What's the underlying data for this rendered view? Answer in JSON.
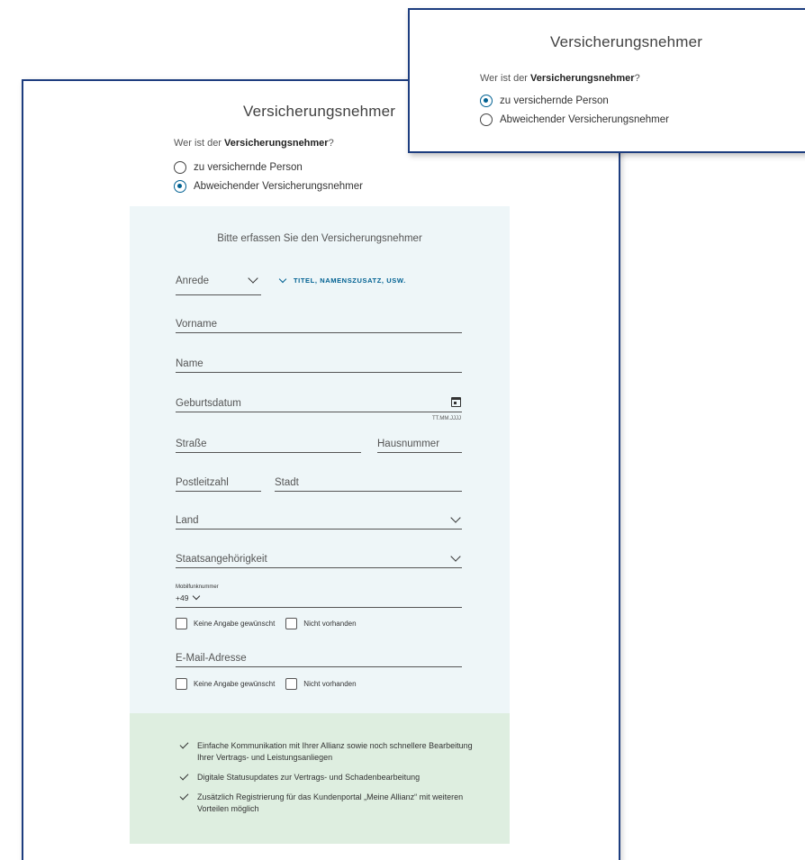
{
  "main": {
    "title": "Versicherungsnehmer",
    "question_prefix": "Wer ist der ",
    "question_bold": "Versicherungsnehmer",
    "question_suffix": "?",
    "options": [
      {
        "label": "zu versichernde Person",
        "checked": false
      },
      {
        "label": "Abweichender Versicherungsnehmer",
        "checked": true
      }
    ],
    "form": {
      "subtitle": "Bitte erfassen Sie den Versicherungsnehmer",
      "anrede": "Anrede",
      "titel_link": "TITEL, NAMENSZUSATZ, USW.",
      "vorname": "Vorname",
      "name": "Name",
      "geburtsdatum": "Geburtsdatum",
      "date_hint": "TT.MM.JJJJ",
      "strasse": "Straße",
      "hausnummer": "Hausnummer",
      "plz": "Postleitzahl",
      "stadt": "Stadt",
      "land": "Land",
      "staatsangehoerigkeit": "Staatsangehörigkeit",
      "mobil_label": "Mobilfunknummer",
      "mobil_prefix": "+49",
      "keine_angabe": "Keine Angabe gewünscht",
      "nicht_vorhanden": "Nicht vorhanden",
      "email": "E-Mail-Adresse"
    },
    "benefits": [
      "Einfache Kommunikation mit Ihrer Allianz sowie noch schnellere Bearbeitung Ihrer Vertrags- und Leistungsanliegen",
      "Digitale Statusupdates zur Vertrags- und Schadenbearbeitung",
      "Zusätzlich Registrierung für das Kundenportal „Meine Allianz“ mit weiteren Vorteilen möglich"
    ]
  },
  "popup": {
    "title": "Versicherungsnehmer",
    "question_prefix": "Wer ist der ",
    "question_bold": "Versicherungsnehmer",
    "question_suffix": "?",
    "options": [
      {
        "label": "zu versichernde Person",
        "checked": true
      },
      {
        "label": "Abweichender Versicherungsnehmer",
        "checked": false
      }
    ]
  },
  "colors": {
    "frame_border": "#1d3d7f",
    "accent": "#006192",
    "form_background": "#eef6f8",
    "benefits_background": "#deeee0"
  }
}
